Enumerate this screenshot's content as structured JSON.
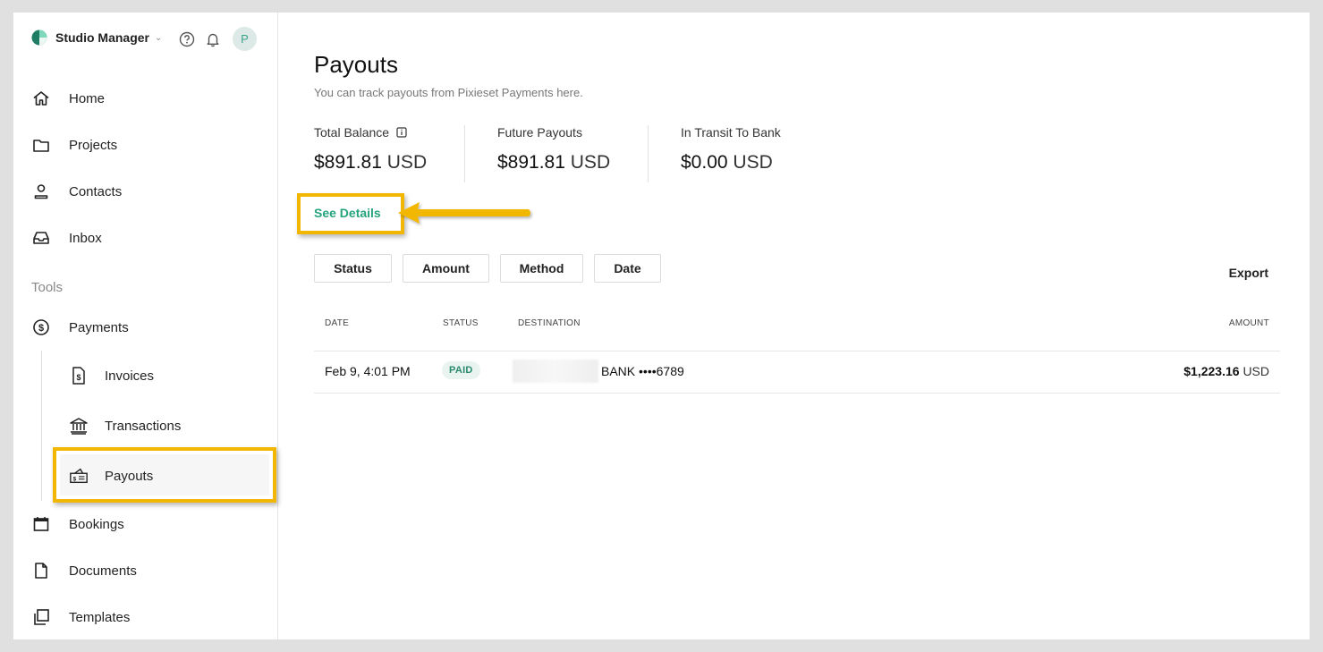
{
  "sidebar": {
    "brand": "Studio Manager",
    "avatar_initial": "P",
    "nav": [
      {
        "label": "Home",
        "icon": "home-icon"
      },
      {
        "label": "Projects",
        "icon": "folder-icon"
      },
      {
        "label": "Contacts",
        "icon": "person-icon"
      },
      {
        "label": "Inbox",
        "icon": "inbox-icon"
      }
    ],
    "tools_label": "Tools",
    "payments_label": "Payments",
    "sub": [
      {
        "label": "Invoices",
        "icon": "invoice-icon"
      },
      {
        "label": "Transactions",
        "icon": "bank-icon"
      },
      {
        "label": "Payouts",
        "icon": "payout-icon",
        "active": true
      }
    ],
    "more": [
      {
        "label": "Bookings",
        "icon": "calendar-icon"
      },
      {
        "label": "Documents",
        "icon": "document-icon"
      },
      {
        "label": "Templates",
        "icon": "templates-icon"
      }
    ]
  },
  "main": {
    "title": "Payouts",
    "subtitle": "You can track payouts from Pixieset Payments here.",
    "stats": [
      {
        "label": "Total Balance",
        "amount": "$891.81",
        "currency": "USD"
      },
      {
        "label": "Future Payouts",
        "amount": "$891.81",
        "currency": "USD"
      },
      {
        "label": "In Transit To Bank",
        "amount": "$0.00",
        "currency": "USD"
      }
    ],
    "see_details": "See Details",
    "filters": [
      "Status",
      "Amount",
      "Method",
      "Date"
    ],
    "export": "Export",
    "table": {
      "headers": {
        "date": "DATE",
        "status": "STATUS",
        "destination": "DESTINATION",
        "amount": "AMOUNT"
      },
      "rows": [
        {
          "date": "Feb 9, 4:01 PM",
          "status": "PAID",
          "destination": "BANK ••••6789",
          "amount": "$1,223.16",
          "currency": "USD"
        }
      ]
    }
  },
  "colors": {
    "accent_green": "#25a37c",
    "highlight": "#f2b705",
    "badge_bg": "#e9f4f0"
  }
}
